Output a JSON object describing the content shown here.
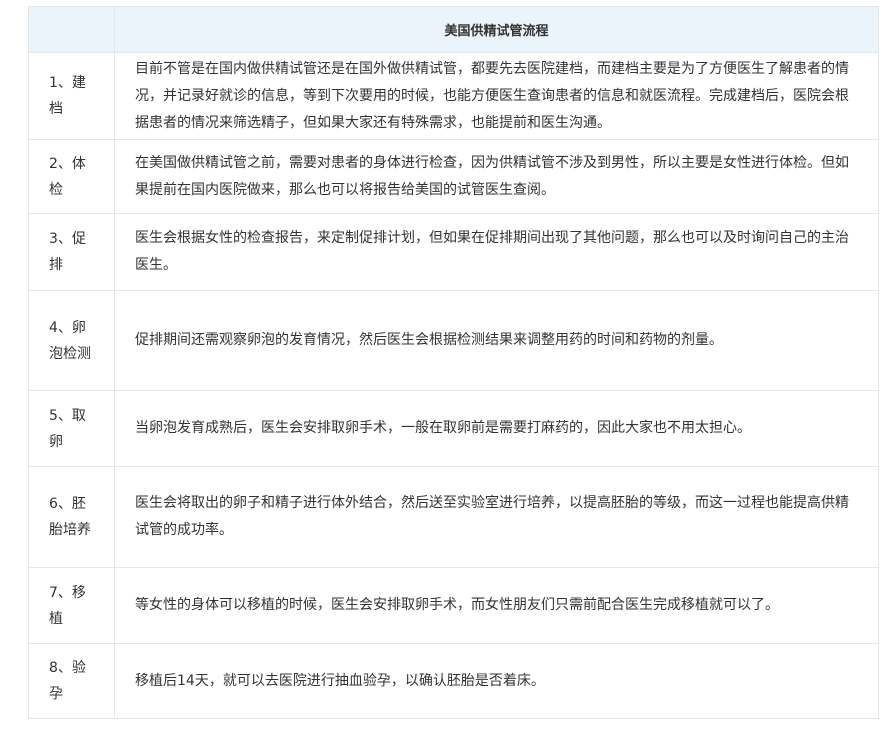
{
  "table": {
    "header": {
      "step": "",
      "title": "美国供精试管流程"
    },
    "rows": [
      {
        "step": "1、建档",
        "desc": "目前不管是在国内做供精试管还是在国外做供精试管，都要先去医院建档，而建档主要是为了方便医生了解患者的情况，并记录好就诊的信息，等到下次要用的时候，也能方便医生查询患者的信息和就医流程。完成建档后，医院会根据患者的情况来筛选精子，但如果大家还有特殊需求，也能提前和医生沟通。"
      },
      {
        "step": "2、体检",
        "desc": "在美国做供精试管之前，需要对患者的身体进行检查，因为供精试管不涉及到男性，所以主要是女性进行体检。但如果提前在国内医院做来，那么也可以将报告给美国的试管医生查阅。"
      },
      {
        "step": "3、促排",
        "desc": "医生会根据女性的检查报告，来定制促排计划，但如果在促排期间出现了其他问题，那么也可以及时询问自己的主治医生。"
      },
      {
        "step": "4、卵泡检测",
        "desc": "促排期间还需观察卵泡的发育情况，然后医生会根据检测结果来调整用药的时间和药物的剂量。"
      },
      {
        "step": "5、取卵",
        "desc": "当卵泡发育成熟后，医生会安排取卵手术，一般在取卵前是需要打麻药的，因此大家也不用太担心。"
      },
      {
        "step": "6、胚胎培养",
        "desc": "医生会将取出的卵子和精子进行体外结合，然后送至实验室进行培养，以提高胚胎的等级，而这一过程也能提高供精试管的成功率。"
      },
      {
        "step": "7、移植",
        "desc": "等女性的身体可以移植的时候，医生会安排取卵手术，而女性朋友们只需前配合医生完成移植就可以了。"
      },
      {
        "step": "8、验孕",
        "desc": "移植后14天，就可以去医院进行抽血验孕，以确认胚胎是否着床。"
      }
    ]
  }
}
